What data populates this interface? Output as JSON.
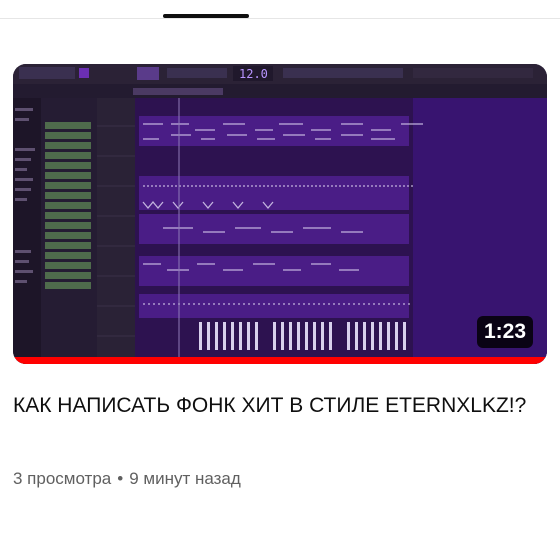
{
  "video": {
    "duration": "1:23",
    "title": "КАК НАПИСАТЬ ФОНК ХИТ В СТИЛЕ ETERNXLKZ!?",
    "views": "3 просмотра",
    "separator": "•",
    "age": "9 минут назад",
    "progress_fraction": 1.0
  },
  "thumbnail": {
    "app": "FL Studio playlist (screenshot)",
    "tempo": "12.0"
  },
  "colors": {
    "progress": "#ff0000",
    "duration_bg": "#000000",
    "title": "#0f0f0f",
    "meta": "#606060",
    "daw_bg": "#2a1246",
    "daw_purple": "#6b2fb3"
  }
}
